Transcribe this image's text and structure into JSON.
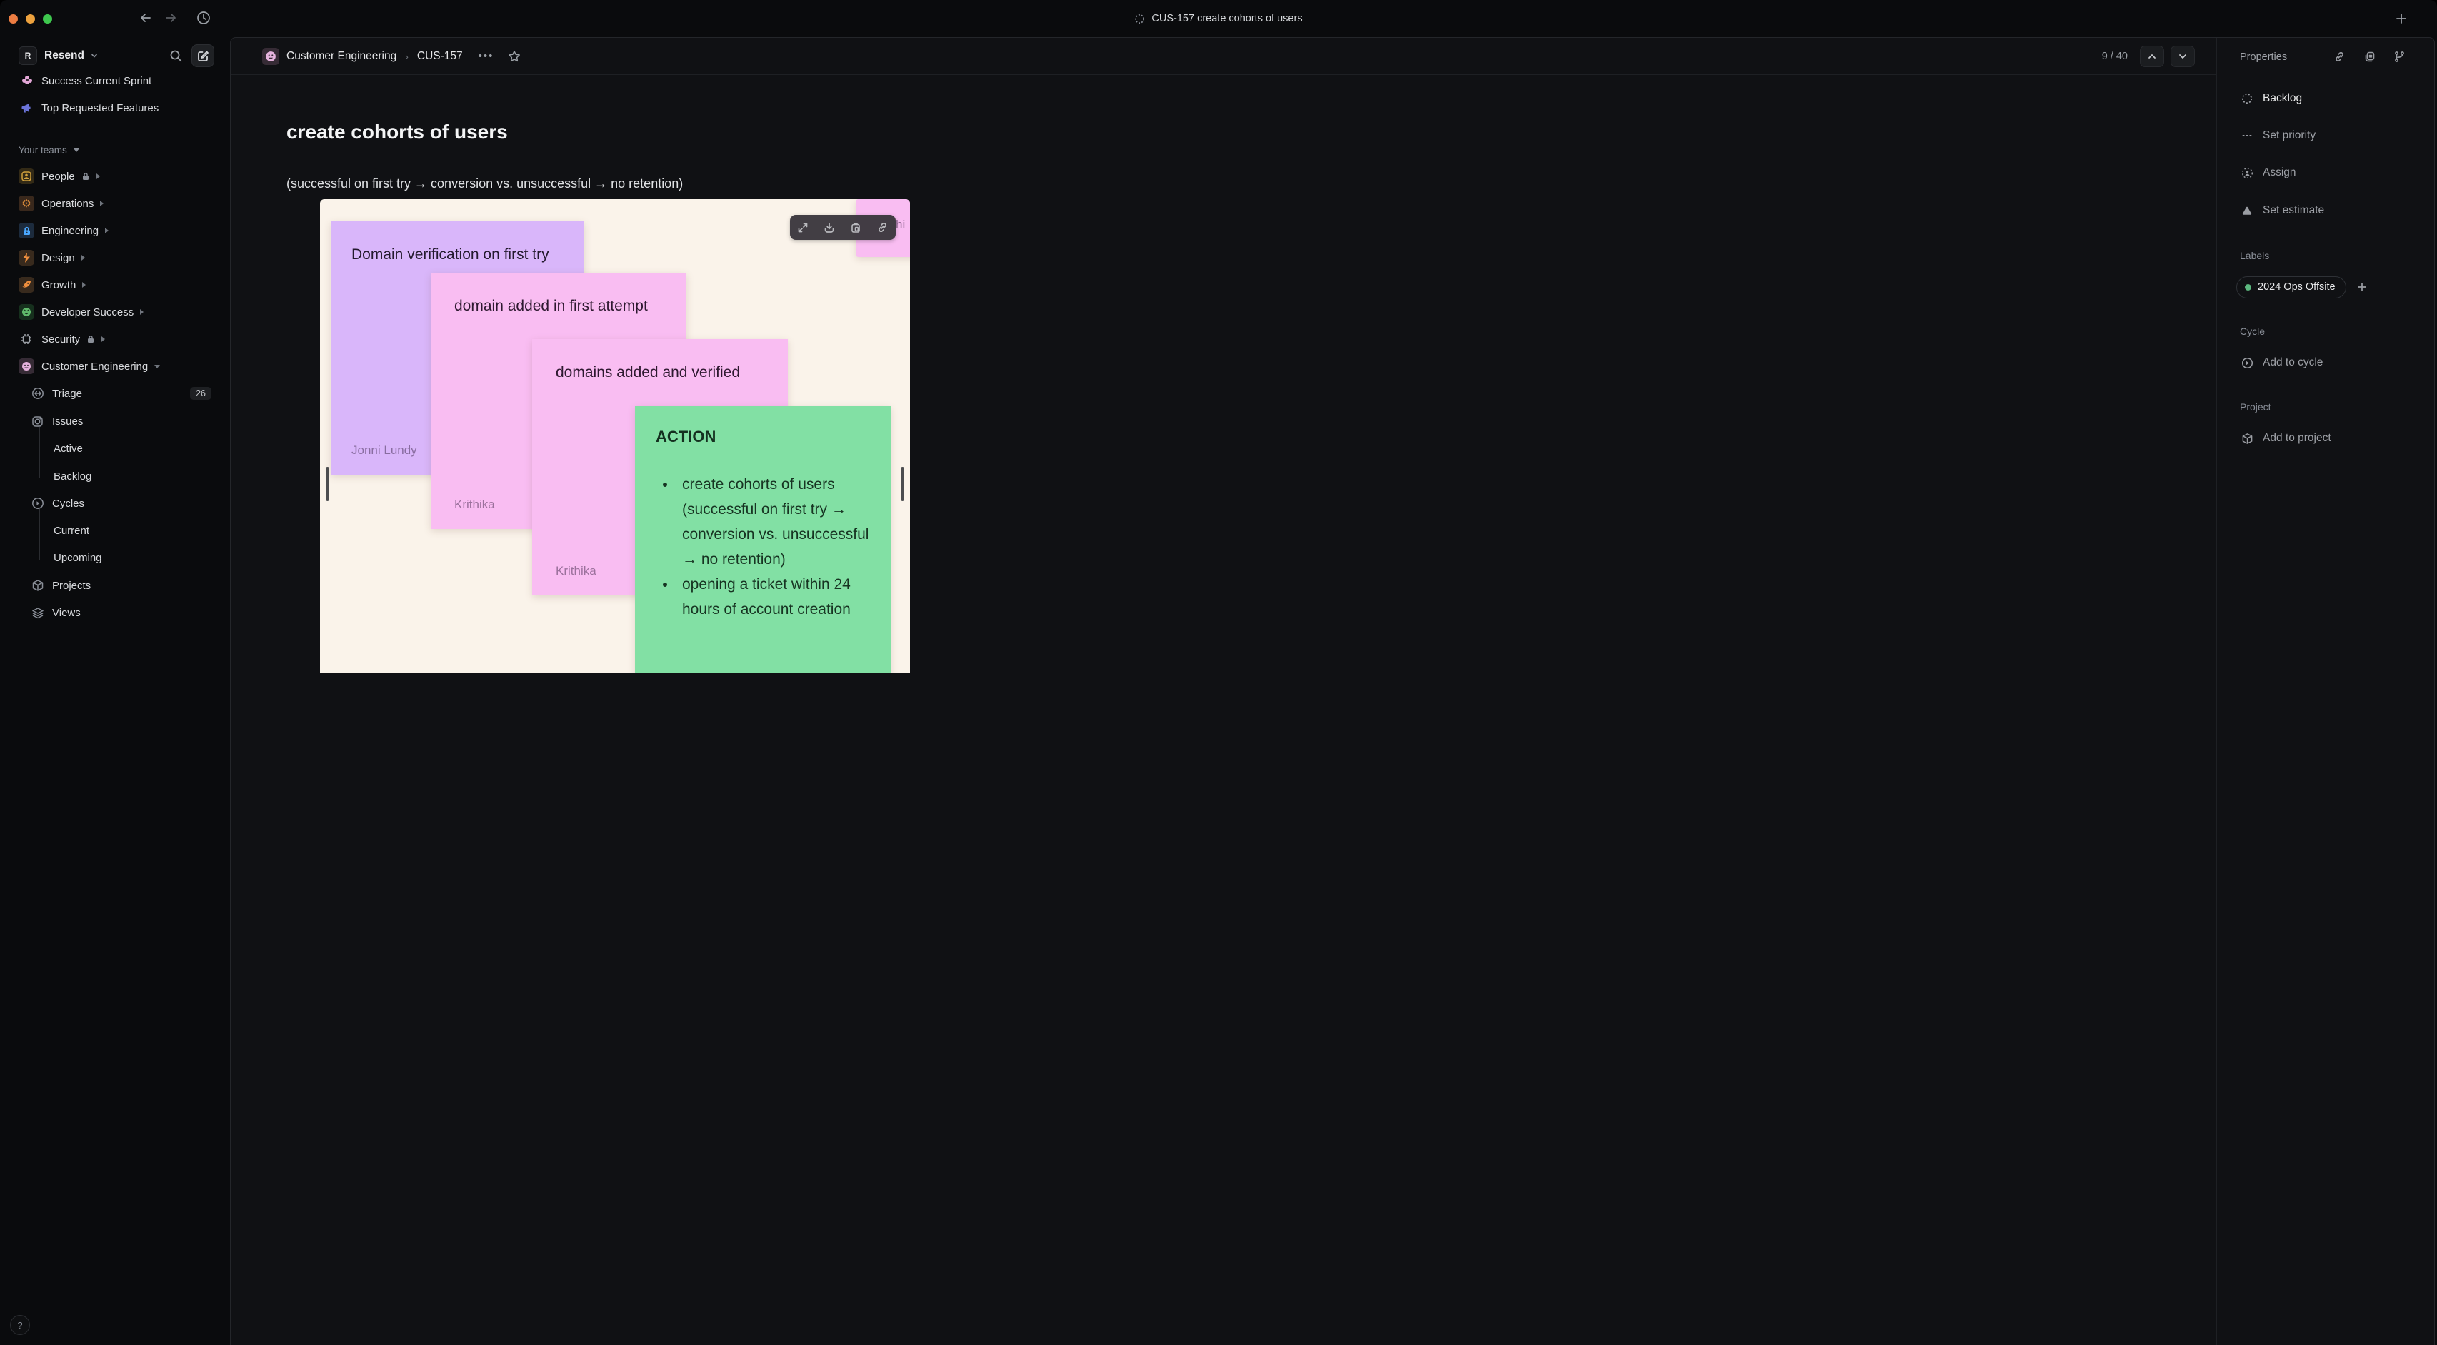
{
  "titlebar": {
    "title": "CUS-157 create cohorts of users"
  },
  "sidebar": {
    "workspace_name": "Resend",
    "workspace_initial": "R",
    "pinned": [
      {
        "label": "Success Current Sprint"
      },
      {
        "label": "Top Requested Features"
      }
    ],
    "teams_header": "Your teams",
    "teams": [
      {
        "label": "People",
        "locked": true
      },
      {
        "label": "Operations",
        "locked": false
      },
      {
        "label": "Engineering",
        "locked": false
      },
      {
        "label": "Design",
        "locked": false
      },
      {
        "label": "Growth",
        "locked": false
      },
      {
        "label": "Developer Success",
        "locked": false
      },
      {
        "label": "Security",
        "locked": true
      },
      {
        "label": "Customer Engineering",
        "locked": false,
        "expanded": true
      }
    ],
    "items": [
      {
        "label": "Triage",
        "badge": "26"
      },
      {
        "label": "Issues"
      },
      {
        "label": "Active"
      },
      {
        "label": "Backlog"
      },
      {
        "label": "Cycles"
      },
      {
        "label": "Current"
      },
      {
        "label": "Upcoming"
      },
      {
        "label": "Projects"
      },
      {
        "label": "Views"
      }
    ],
    "help": "?"
  },
  "header": {
    "breadcrumb_team": "Customer Engineering",
    "breadcrumb_issue": "CUS-157",
    "more": "•••",
    "pager": "9 / 40"
  },
  "issue": {
    "title": "create cohorts of users",
    "subtitle": "(successful on first try → conversion vs. unsuccessful → no retention)"
  },
  "whiteboard": {
    "toolbar_icons": [
      "expand",
      "download",
      "copy-to-clipboard",
      "copy-link"
    ],
    "notes": {
      "purple": {
        "text": "Domain verification on first try",
        "author": "Jonni Lundy"
      },
      "pink1": {
        "text": "domain added in first attempt",
        "author": "Krithika"
      },
      "pink2": {
        "text": "domains added and verified",
        "author": "Krithika"
      },
      "green": {
        "title": "ACTION",
        "bullet1": "create cohorts of users (successful on first try → conversion vs. unsuccessful → no retention)",
        "bullet2": "opening a ticket within 24 hours of account creation"
      },
      "partial": {
        "fragment": "hi"
      }
    }
  },
  "properties": {
    "title": "Properties",
    "status": "Backlog",
    "set_priority": "Set priority",
    "assign": "Assign",
    "set_estimate": "Set estimate",
    "labels_header": "Labels",
    "label_pill": "2024 Ops Offsite",
    "cycle_header": "Cycle",
    "add_to_cycle": "Add to cycle",
    "project_header": "Project",
    "add_to_project": "Add to project"
  },
  "colors": {
    "label_dot": "#5cb87f",
    "note_purple": "#d9b6fa",
    "note_pink": "#f9bdf2",
    "note_green": "#82e0a4",
    "board_bg": "#faf3ea",
    "panel_bg": "#101114",
    "sidebar_bg": "#0a0b0d"
  }
}
